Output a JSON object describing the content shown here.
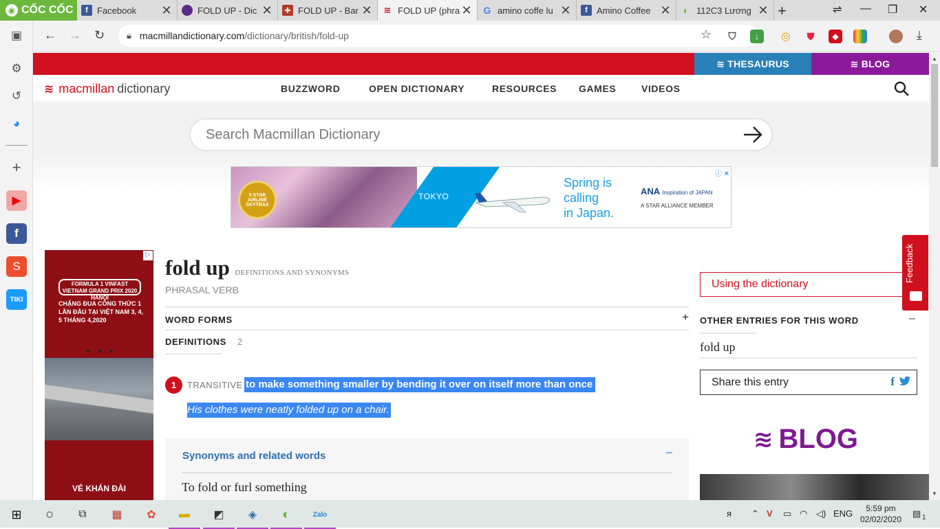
{
  "browser": {
    "brand": "CỐC CỐC",
    "tabs": [
      {
        "title": "Facebook",
        "favicon": "facebook-icon",
        "color": "#3b5998",
        "active": false
      },
      {
        "title": "FOLD UP - Dic",
        "favicon": "dictionary-icon",
        "color": "#5b2a86",
        "active": false
      },
      {
        "title": "FOLD UP - Bar",
        "favicon": "cambridge-icon",
        "color": "#b33a2a",
        "active": false
      },
      {
        "title": "FOLD UP (phra",
        "favicon": "macmillan-icon",
        "color": "#d0101e",
        "active": true
      },
      {
        "title": "amino coffe lu",
        "favicon": "google-icon",
        "color": "#ffffff",
        "active": false
      },
      {
        "title": "Amino Coffee",
        "favicon": "facebook-icon",
        "color": "#3b5998",
        "active": false
      },
      {
        "title": "112C3 Lương",
        "favicon": "coccoc-icon",
        "color": "#6bb83c",
        "active": false
      }
    ],
    "url_host": "macmillandictionary.com",
    "url_path": "/dictionary/british/fold-up"
  },
  "site": {
    "thesaurus_label": "THESAURUS",
    "blog_label": "BLOG",
    "logo_text_1": "macmillan",
    "logo_text_2": "dictionary",
    "nav": [
      "BUZZWORD",
      "OPEN DICTIONARY",
      "RESOURCES",
      "GAMES",
      "VIDEOS"
    ],
    "search_placeholder": "Search Macmillan Dictionary"
  },
  "ad_banner": {
    "seal": "5 STAR AIRLINE SKYTRAX",
    "city": "TOKYO",
    "headline_1": "Spring is",
    "headline_2": "calling",
    "headline_3": "in Japan.",
    "brand": "ANA",
    "brand_tagline": "Inspiration of JAPAN",
    "alliance": "A STAR ALLIANCE MEMBER"
  },
  "side_ad": {
    "event": "FORMULA 1 VINFAST VIETNAM GRAND PRIX 2020 HANOI",
    "text": "CHẶNG ĐUA CÔNG THỨC 1 LẦN ĐẦU TẠI VIỆT NAM 3, 4, 5 THÁNG 4,2020",
    "cta": "VÉ KHÁN ĐÀI"
  },
  "entry": {
    "headword": "fold up",
    "subtitle": "DEFINITIONS AND SYNONYMS",
    "pos": "PHRASAL VERB",
    "word_forms_label": "WORD FORMS",
    "word_forms_toggle": "+",
    "definitions_label": "DEFINITIONS",
    "definitions_count": "2",
    "sense": {
      "number": "1",
      "grammar": "TRANSITIVE",
      "definition": "to make something smaller by bending it over on itself more than once",
      "example": "His clothes were neatly folded up on a chair."
    },
    "synonyms_title": "Synonyms and related words",
    "synonyms_toggle": "–",
    "synonyms_subtitle": "To fold or furl something"
  },
  "sidebar_right": {
    "using_dictionary": "Using the dictionary",
    "other_entries_label": "OTHER ENTRIES FOR THIS WORD",
    "other_toggle": "–",
    "other_item": "fold up",
    "share_label": "Share this entry",
    "blog_big": "BLOG",
    "feedback": "Feedback"
  },
  "taskbar": {
    "language": "ENG",
    "time": "5:59 pm",
    "date": "02/02/2020",
    "notification_count": "1"
  },
  "colors": {
    "brand_red": "#d0101e",
    "thesaurus_blue": "#2980b9",
    "blog_purple": "#8b1a9b",
    "selection_blue": "#3a87f2"
  }
}
